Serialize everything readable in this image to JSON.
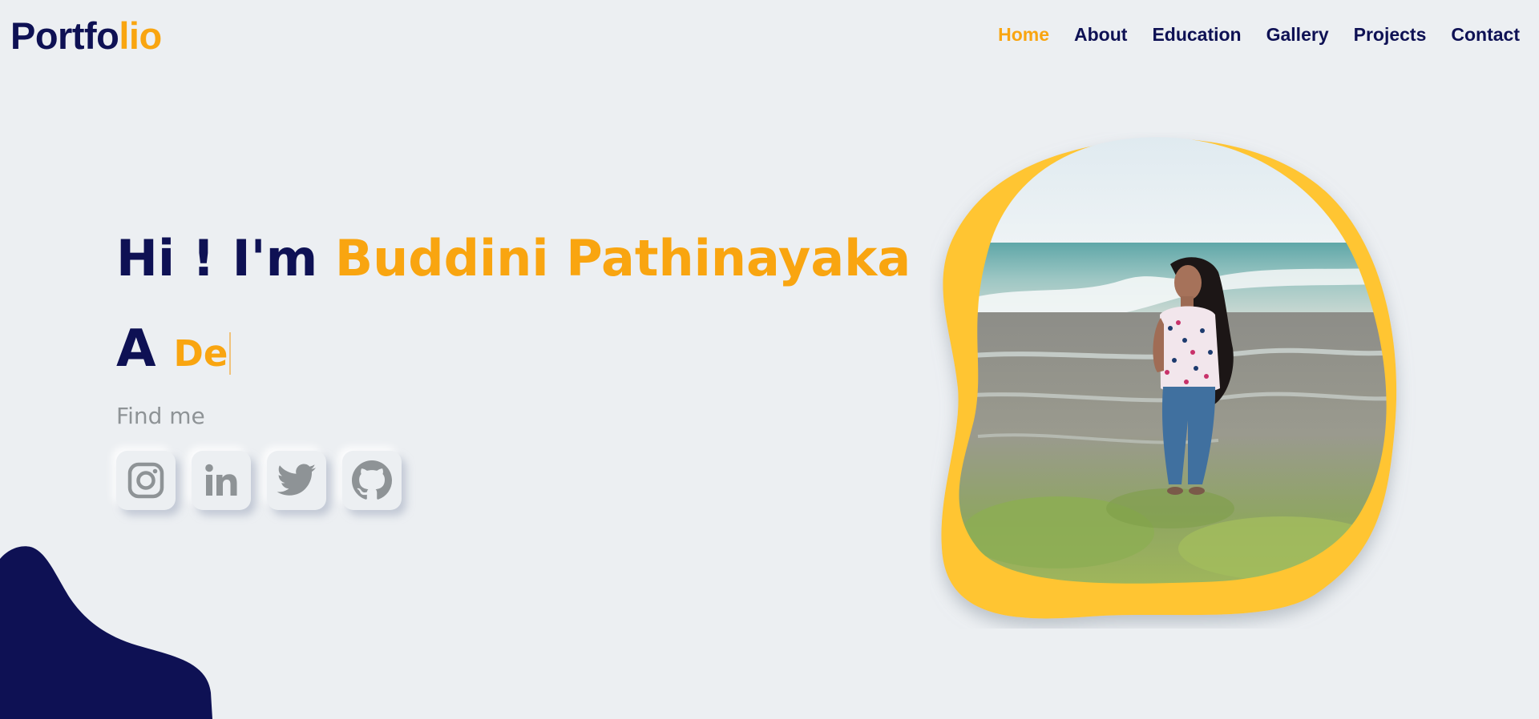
{
  "header": {
    "logo_part1": "Portfo",
    "logo_part2": "lio",
    "nav": [
      {
        "label": "Home",
        "active": true
      },
      {
        "label": "About",
        "active": false
      },
      {
        "label": "Education",
        "active": false
      },
      {
        "label": "Gallery",
        "active": false
      },
      {
        "label": "Projects",
        "active": false
      },
      {
        "label": "Contact",
        "active": false
      }
    ]
  },
  "hero": {
    "greeting": "Hi ! I'm ",
    "name": "Buddini Pathinayaka",
    "article": "A",
    "typed_role": "De",
    "find_me": "Find me"
  },
  "socials": [
    {
      "icon": "instagram-icon"
    },
    {
      "icon": "linkedin-icon"
    },
    {
      "icon": "twitter-icon"
    },
    {
      "icon": "github-icon"
    }
  ],
  "colors": {
    "background": "#eceff2",
    "navy": "#0e1154",
    "accent": "#f9a510",
    "blob_yellow": "#ffc532",
    "icon_gray": "#8e9396"
  }
}
